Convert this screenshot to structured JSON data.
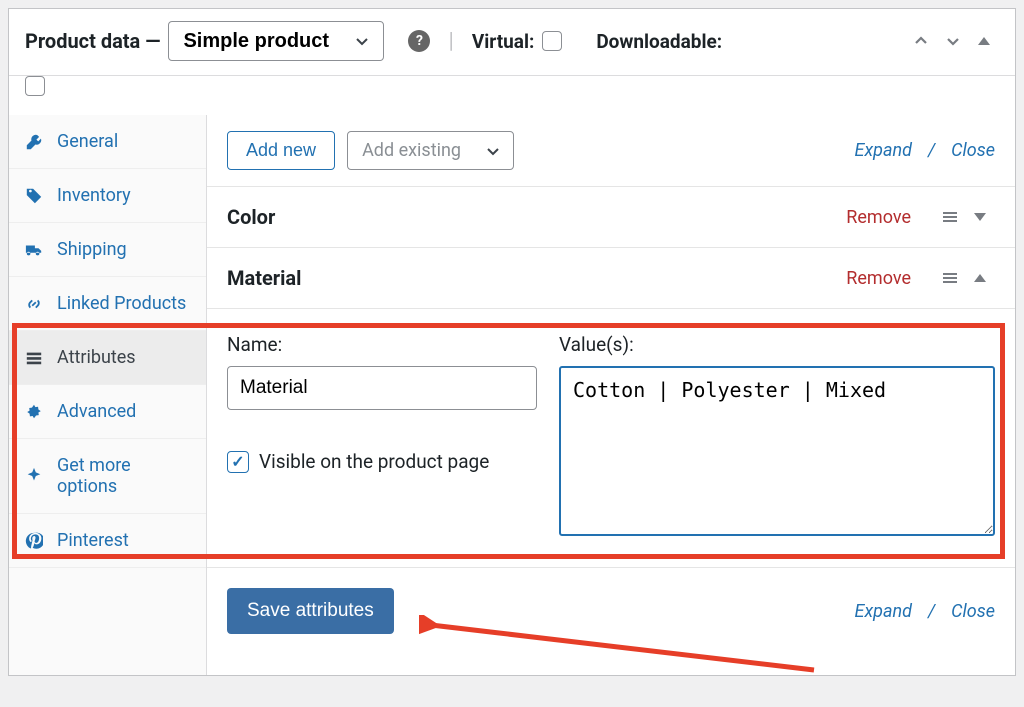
{
  "header": {
    "title": "Product data —",
    "product_type": "Simple product",
    "virtual_label": "Virtual:",
    "downloadable_label": "Downloadable:"
  },
  "sidebar": {
    "items": [
      {
        "label": "General"
      },
      {
        "label": "Inventory"
      },
      {
        "label": "Shipping"
      },
      {
        "label": "Linked Products"
      },
      {
        "label": "Attributes"
      },
      {
        "label": "Advanced"
      },
      {
        "label": "Get more options"
      },
      {
        "label": "Pinterest"
      }
    ]
  },
  "toolbar": {
    "add_new": "Add new",
    "add_existing_placeholder": "Add existing",
    "expand": "Expand",
    "close": "Close"
  },
  "attributes": [
    {
      "name": "Color",
      "expanded": false
    },
    {
      "name": "Material",
      "expanded": true
    }
  ],
  "material": {
    "name_label": "Name:",
    "name_value": "Material",
    "values_label": "Value(s):",
    "values_value": "Cotton | Polyester | Mixed",
    "visible_label": "Visible on the product page",
    "visible_checked": true
  },
  "actions": {
    "remove": "Remove",
    "save": "Save attributes"
  }
}
